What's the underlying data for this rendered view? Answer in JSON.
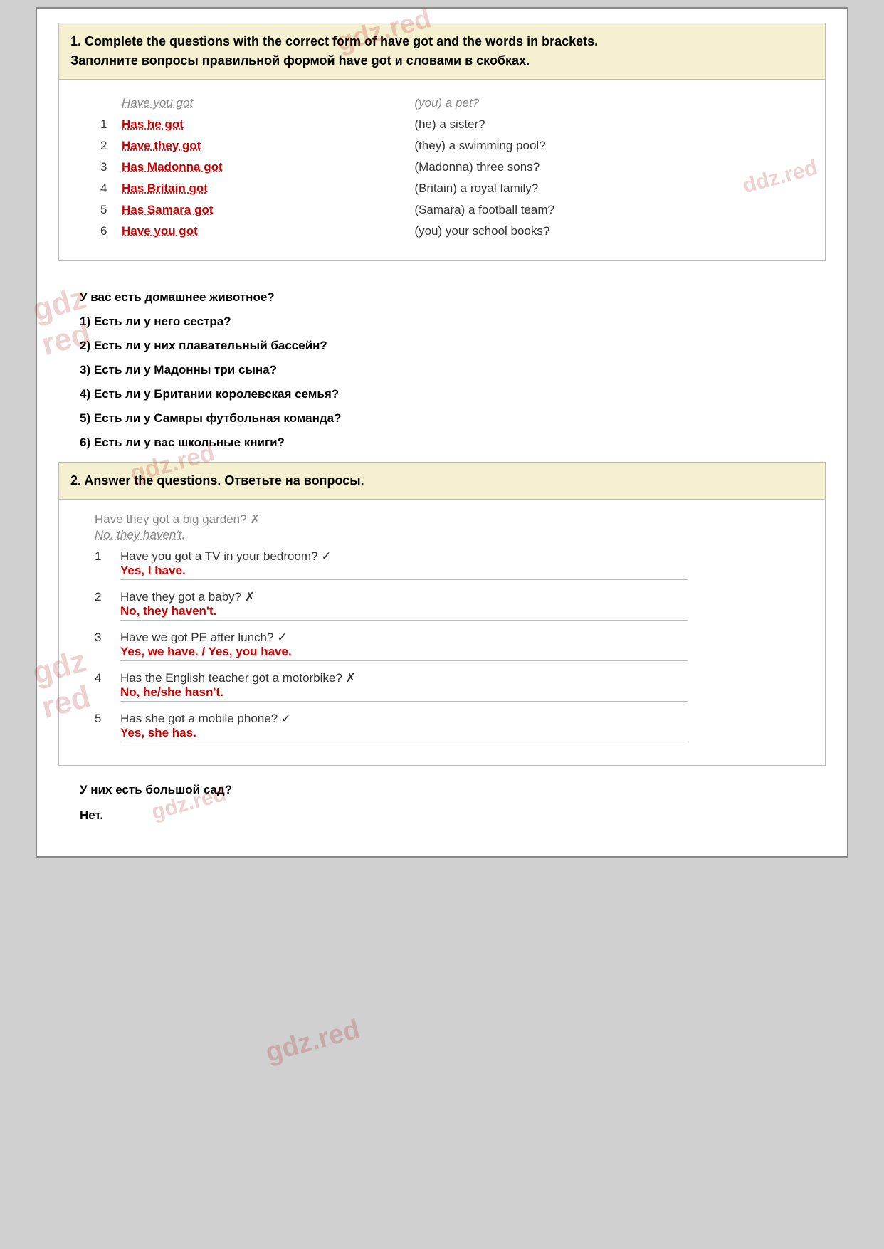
{
  "watermarks": [
    "gdz.red",
    "ddz.red",
    "gdz red",
    "gdz.red",
    "gdz.red",
    "gdz.red",
    "gdz.red"
  ],
  "exercise1": {
    "header": "1. Complete the questions with the correct form of have got  and the words in brackets.",
    "header_ru": "Заполните вопросы правильной формой have got и словами в скобках.",
    "example": {
      "answer": "Have you got",
      "bracket": "(you) a pet?"
    },
    "rows": [
      {
        "num": "1",
        "answer": "Has he got",
        "bracket": "(he) a sister?"
      },
      {
        "num": "2",
        "answer": "Have they got",
        "bracket": "(they) a swimming pool?"
      },
      {
        "num": "3",
        "answer": "Has Madonna got",
        "bracket": "(Madonna) three sons?"
      },
      {
        "num": "4",
        "answer": "Has Britain got",
        "bracket": "(Britain) a royal family?"
      },
      {
        "num": "5",
        "answer": "Has Samara got",
        "bracket": "(Samara) a football team?"
      },
      {
        "num": "6",
        "answer": "Have you got",
        "bracket": "(you) your school books?"
      }
    ],
    "translations": [
      "У вас есть домашнее животное?",
      "1) Есть ли у него сестра?",
      "2) Есть ли у них плавательный бассейн?",
      "3) Есть ли у Мадонны три сына?",
      "4) Есть ли у Британии королевская семья?",
      "5) Есть ли у Самары футбольная команда?",
      "6) Есть ли у вас школьные книги?"
    ]
  },
  "exercise2": {
    "header": "2. Answer the questions. Ответьте на вопросы.",
    "example": {
      "question": "Have they got a big garden? ✗",
      "answer": "No, they haven't."
    },
    "rows": [
      {
        "num": "1",
        "question": "Have you got a TV in your bedroom? ✓",
        "answer": "Yes, I have."
      },
      {
        "num": "2",
        "question": "Have they got a baby? ✗",
        "answer": "No, they haven't."
      },
      {
        "num": "3",
        "question": "Have we got PE after lunch? ✓",
        "answer": "Yes, we have. / Yes, you have."
      },
      {
        "num": "4",
        "question": "Has the English teacher got a motorbike? ✗",
        "answer": "No, he/she hasn't."
      },
      {
        "num": "5",
        "question": "Has she got a mobile phone? ✓",
        "answer": "Yes, she has."
      }
    ],
    "translations": [
      "У них есть большой сад?",
      "Нет."
    ]
  }
}
